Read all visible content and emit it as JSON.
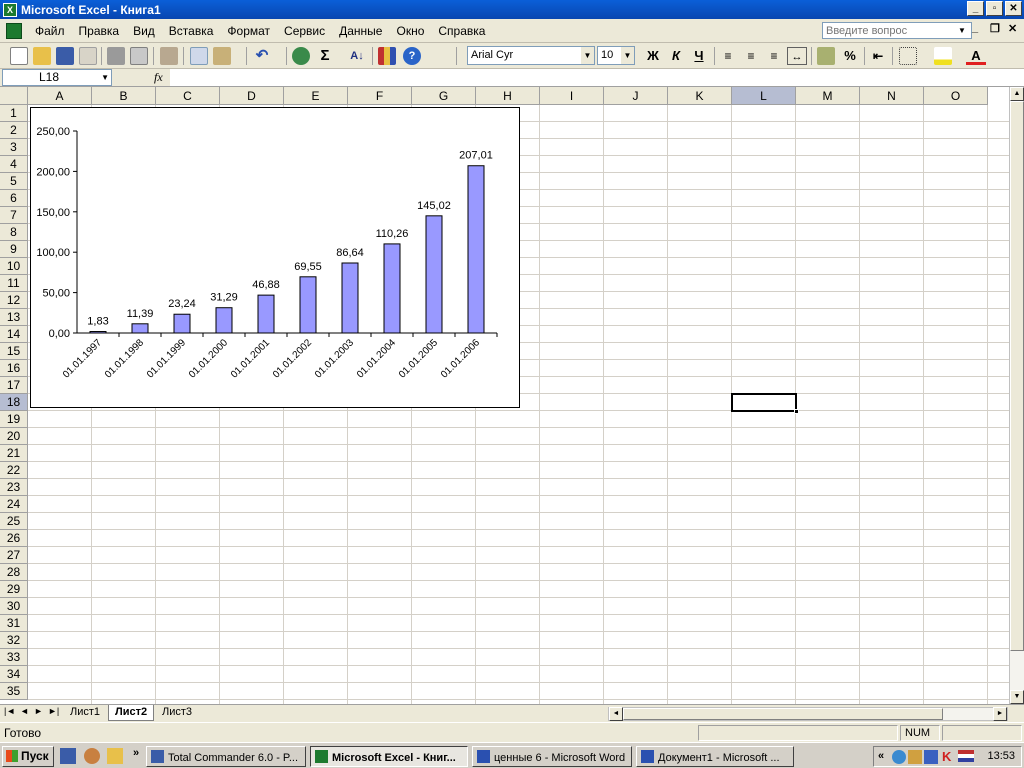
{
  "window": {
    "title": "Microsoft Excel - Книга1",
    "minimize": "_",
    "maximize": "▫",
    "close": "✕"
  },
  "menu": {
    "items": [
      "Файл",
      "Правка",
      "Вид",
      "Вставка",
      "Формат",
      "Сервис",
      "Данные",
      "Окно",
      "Справка"
    ],
    "ask_placeholder": "Введите вопрос"
  },
  "toolbar": {
    "font_name": "Arial Cyr",
    "font_size": "10",
    "bold": "Ж",
    "italic": "К",
    "underline": "Ч",
    "percent": "%"
  },
  "formula": {
    "cell_ref": "L18",
    "fx": "fx",
    "value": ""
  },
  "grid": {
    "columns": [
      "A",
      "B",
      "C",
      "D",
      "E",
      "F",
      "G",
      "H",
      "I",
      "J",
      "K",
      "L",
      "M",
      "N",
      "O"
    ],
    "rows": [
      "1",
      "2",
      "3",
      "4",
      "5",
      "6",
      "7",
      "8",
      "9",
      "10",
      "11",
      "12",
      "13",
      "14",
      "15",
      "16",
      "17",
      "18",
      "19",
      "20",
      "21",
      "22",
      "23",
      "24",
      "25",
      "26",
      "27",
      "28",
      "29",
      "30",
      "31",
      "32",
      "33",
      "34",
      "35"
    ],
    "selected_col": "L",
    "selected_row": "18"
  },
  "chart_data": {
    "type": "bar",
    "categories": [
      "01.01.1997",
      "01.01.1998",
      "01.01.1999",
      "01.01.2000",
      "01.01.2001",
      "01.01.2002",
      "01.01.2003",
      "01.01.2004",
      "01.01.2005",
      "01.01.2006"
    ],
    "values": [
      1.83,
      11.39,
      23.24,
      31.29,
      46.88,
      69.55,
      86.64,
      110.26,
      145.02,
      207.01
    ],
    "value_labels": [
      "1,83",
      "11,39",
      "23,24",
      "31,29",
      "46,88",
      "69,55",
      "86,64",
      "110,26",
      "145,02",
      "207,01"
    ],
    "yticks": [
      "0,00",
      "50,00",
      "100,00",
      "150,00",
      "200,00",
      "250,00"
    ],
    "ylim": [
      0,
      250
    ],
    "title": "",
    "xlabel": "",
    "ylabel": "",
    "bar_color": "#9999ff",
    "grid": false,
    "legend": false
  },
  "sheets": {
    "tabs": [
      "Лист1",
      "Лист2",
      "Лист3"
    ],
    "active": "Лист2"
  },
  "status": {
    "text": "Готово",
    "num": "NUM"
  },
  "taskbar": {
    "start": "Пуск",
    "tasks": [
      "Total Commander 6.0 - P...",
      "Microsoft Excel - Книг...",
      "ценные 6 - Microsoft Word",
      "Документ1 - Microsoft ..."
    ],
    "active_task": "Microsoft Excel - Книг...",
    "clock": "13:53",
    "chevron": "»",
    "tray_chevron": "«"
  }
}
